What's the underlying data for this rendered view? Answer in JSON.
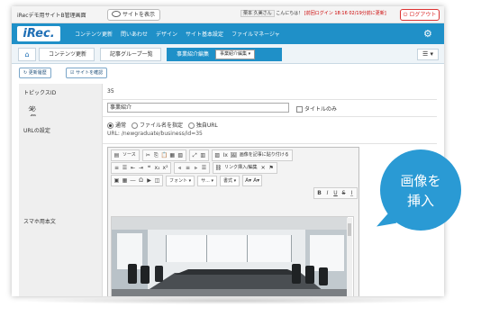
{
  "topbar": {
    "site_title": "iRecデモ用サイトB管理画面",
    "view_site": "サイトを表示",
    "user_name": "栗本 久美さん",
    "greeting": "こんにちは！",
    "last_login_label": "[前回ログイン 18:16 02/19分前に更新]",
    "logout": "ログアウト"
  },
  "nav": {
    "logo": "iRec.",
    "items": [
      "コンテンツ更新",
      "問いあわせ",
      "デザイン",
      "サイト基本設定",
      "ファイルマネージャ"
    ]
  },
  "breadcrumb": {
    "items": [
      "コンテンツ更新",
      "記事グループ一覧",
      "事業紹介編集"
    ],
    "select_value": "事業紹介編集"
  },
  "actions": {
    "history": "更新履歴",
    "preview": "サイトを確認"
  },
  "form": {
    "topic_id_label": "トピックスID",
    "topic_id_value": "35",
    "title_label": "タイトル",
    "required": "必須",
    "title_value": "事業紹介",
    "title_only": "タイトルのみ",
    "url_label": "URLの設定",
    "url_options": [
      "通常",
      "ファイル名を指定",
      "独自URL"
    ],
    "url_value": "URL: /newgraduate/business/id=35",
    "body_label": "スマホ用本文"
  },
  "editor": {
    "source": "ソース",
    "paste_image": "画像を記事に貼り付ける",
    "insert_link": "リンク挿入/編集",
    "font": "フォント",
    "size": "サ...",
    "format": "書式"
  },
  "callout": {
    "line1": "画像を",
    "line2": "挿入"
  },
  "colors": {
    "nav_blue": "#1f90c8",
    "bubble_blue": "#2a9ad4",
    "logout_red": "#d33333"
  }
}
